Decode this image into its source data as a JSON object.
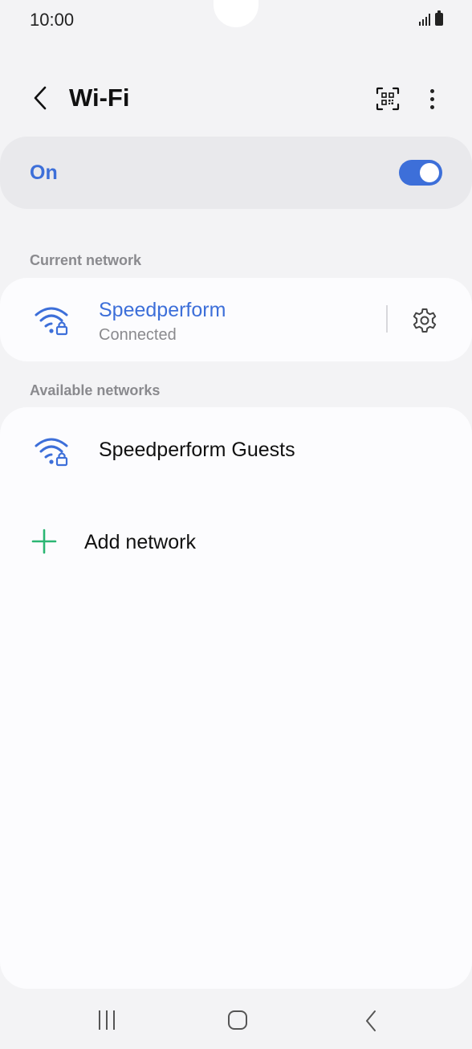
{
  "status_bar": {
    "time": "10:00"
  },
  "header": {
    "title": "Wi-Fi"
  },
  "master_switch": {
    "label": "On",
    "state": "on"
  },
  "sections": {
    "current_label": "Current network",
    "available_label": "Available networks"
  },
  "current_network": {
    "name": "Speedperform",
    "status": "Connected"
  },
  "available_networks": [
    {
      "name": "Speedperform Guests"
    }
  ],
  "add_network": {
    "label": "Add network"
  },
  "colors": {
    "accent": "#3d6fd9",
    "add_icon": "#2bb673",
    "background": "#f3f3f5",
    "card": "#fcfcfe"
  },
  "icons": [
    "back-arrow-icon",
    "qr-code-icon",
    "more-options-icon",
    "wifi-lock-icon",
    "gear-icon",
    "plus-icon",
    "recents-icon",
    "home-icon",
    "back-icon"
  ]
}
